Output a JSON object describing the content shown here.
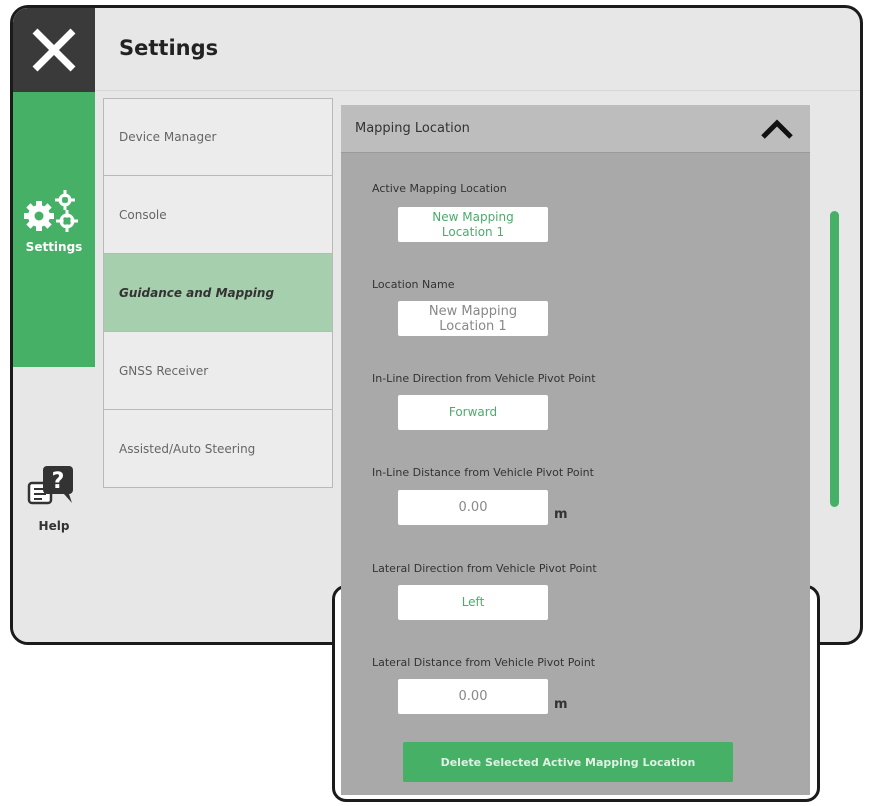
{
  "header": {
    "title": "Settings"
  },
  "rail": {
    "close_icon": "close-icon",
    "settings_label": "Settings",
    "settings_icon": "gears-icon",
    "help_label": "Help",
    "help_icon": "help-chat-icon"
  },
  "nav": {
    "items": [
      {
        "label": "Device Manager"
      },
      {
        "label": "Console"
      },
      {
        "label": "Guidance and Mapping",
        "active": true
      },
      {
        "label": "GNSS Receiver"
      },
      {
        "label": "Assisted/Auto Steering"
      }
    ]
  },
  "panel": {
    "title": "Mapping Location",
    "collapse_icon": "chevron-up-icon",
    "active_location": {
      "label": "Active Mapping Location",
      "value_line1": "New Mapping",
      "value_line2": "Location 1"
    },
    "location_name": {
      "label": "Location Name",
      "value_line1": "New Mapping",
      "value_line2": "Location 1"
    },
    "inline_direction": {
      "label": "In-Line Direction from Vehicle Pivot Point",
      "value": "Forward"
    },
    "inline_distance": {
      "label": "In-Line Distance from Vehicle Pivot Point",
      "value": "0.00",
      "unit": "m"
    },
    "lateral_direction": {
      "label": "Lateral Direction from Vehicle Pivot Point",
      "value": "Left"
    },
    "lateral_distance": {
      "label": "Lateral Distance from Vehicle Pivot Point",
      "value": "0.00",
      "unit": "m"
    },
    "delete_button": "Delete Selected Active Mapping Location"
  },
  "colors": {
    "accent": "#45b066",
    "active_nav": "#a6cfae",
    "panel_bg": "#a9a9a9",
    "rail_dark": "#3a3a3a"
  }
}
